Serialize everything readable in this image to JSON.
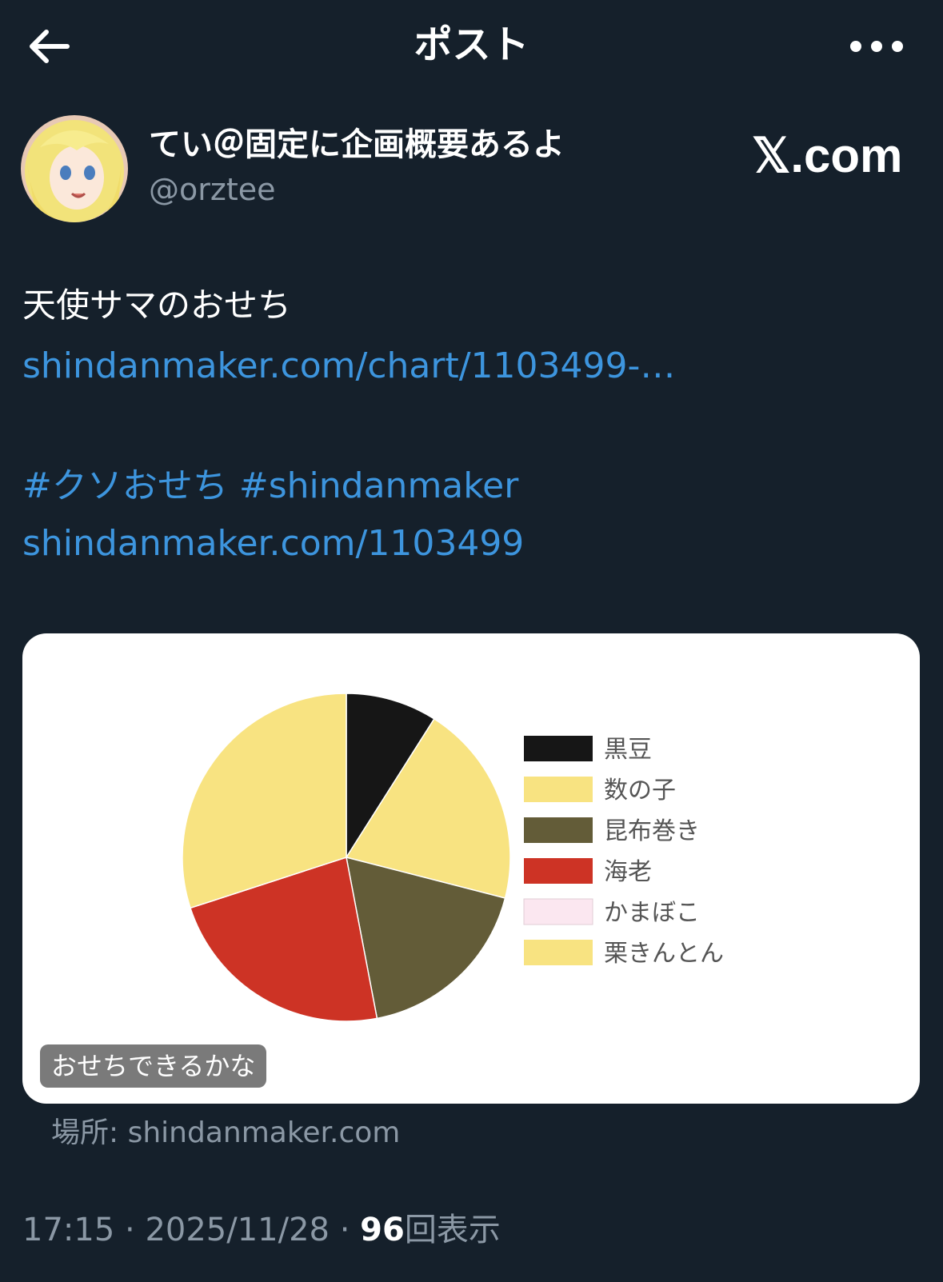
{
  "header": {
    "title": "ポスト",
    "back_icon": "arrow-left-icon",
    "more_icon": "more-dots-icon"
  },
  "author": {
    "display_name": "てい＠固定に企画概要あるよ",
    "handle": "@orztee"
  },
  "watermark": "𝕏.com",
  "tweet": {
    "text": "天使サマのおせち",
    "link1": "shindanmaker.com/chart/1103499-…",
    "hashtag1": "#クソおせち",
    "hashtag2": "#shindanmaker",
    "link2": "shindanmaker.com/1103499"
  },
  "card": {
    "badge": "おせちできるかな",
    "source": "場所: shindanmaker.com"
  },
  "chart_data": {
    "type": "pie",
    "title": "",
    "slices": [
      {
        "label": "黒豆",
        "value": 9,
        "color": "#161616"
      },
      {
        "label": "数の子",
        "value": 20,
        "color": "#f8e381"
      },
      {
        "label": "昆布巻き",
        "value": 18,
        "color": "#635c38"
      },
      {
        "label": "海老",
        "value": 23,
        "color": "#cd3325"
      },
      {
        "label": "かまぼこ",
        "value": 0,
        "color": "#fbe7f0"
      },
      {
        "label": "栗きんとん",
        "value": 30,
        "color": "#f8e381"
      }
    ],
    "legend_position": "right"
  },
  "meta": {
    "time": "17:15",
    "date": "2025/11/28",
    "separator": "·",
    "views_count": "96",
    "views_label": "回表示"
  },
  "colors": {
    "background": "#15202b",
    "link": "#3d95de",
    "secondary_text": "#8b98a5"
  }
}
